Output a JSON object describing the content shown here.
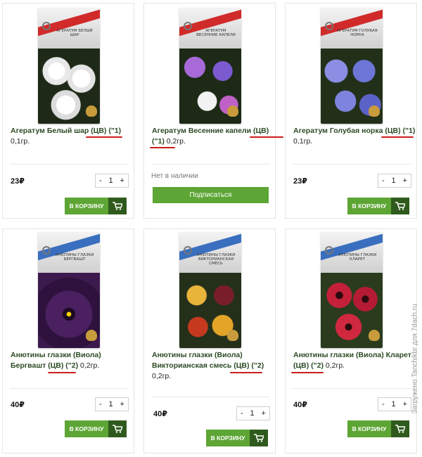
{
  "currency_symbol": "₽",
  "cart_label": "В КОРЗИНУ",
  "subscribe_label": "Подписаться",
  "out_of_stock_label": "Нет в наличии",
  "stepper": {
    "minus": "-",
    "plus": "+",
    "qty": "1"
  },
  "products": [
    {
      "title": "Агератум Белый шар (ЦВ) (\"1)",
      "weight": "0,1гр.",
      "price": "23₽",
      "pack_title": "АГЕРАТУМ Белый шар",
      "flower_color": "#f3f3f3"
    },
    {
      "title": "Агератум Весенние капели (ЦВ) (\"1)",
      "weight": "0,2гр.",
      "price": "",
      "pack_title": "АГЕРАТУМ Весенние капели",
      "flower_color": "#8a4cc2"
    },
    {
      "title": "Агератум Голубая норка (ЦВ) (\"1)",
      "weight": "0,1гр.",
      "price": "23₽",
      "pack_title": "АГЕРАТУМ Голубая норка",
      "flower_color": "#6b73d1"
    },
    {
      "title": "Анютины глазки (Виола) Бергвашт (ЦВ) (\"2)",
      "weight": "0,2гр.",
      "price": "40₽",
      "pack_title": "АНЮТИНЫ ГЛАЗКИ Бергвашт",
      "flower_color": "#3d1a4d"
    },
    {
      "title": "Анютины глазки (Виола) Викторианская смесь (ЦВ) (\"2)",
      "weight": "0,2гр.",
      "price": "40₽",
      "pack_title": "АНЮТИНЫ ГЛАЗКИ Викторианская смесь",
      "flower_color": "#d7a42c"
    },
    {
      "title": "Анютины глазки (Виола) Кларет (ЦВ) (\"2)",
      "weight": "0,2гр.",
      "price": "40₽",
      "pack_title": "АНЮТИНЫ ГЛАЗКИ Кларет",
      "flower_color": "#c4203a"
    }
  ],
  "watermark": "Загружено Tanchikbr для 7dach.ru",
  "colors": {
    "accent_green": "#5da534",
    "dark_green": "#2f5a1d",
    "underline_red": "#cc1d1d"
  }
}
